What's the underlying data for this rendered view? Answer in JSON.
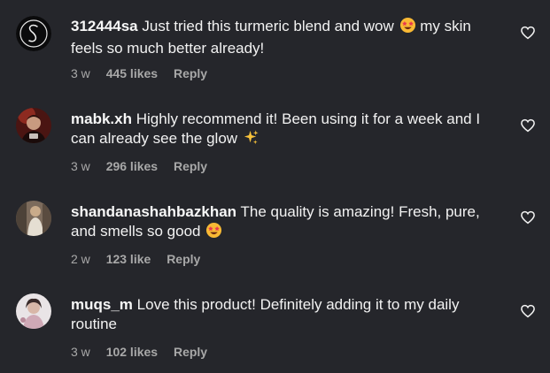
{
  "comments": [
    {
      "username": "312444sa",
      "text": "Just tried this turmeric blend and wow",
      "text_after_emoji": "my skin feels so much better already!",
      "emoji": "star-struck-emoji",
      "time": "3 w",
      "likes": "445 likes",
      "reply": "Reply"
    },
    {
      "username": "mabk.xh",
      "text": "Highly recommend it! Been using it for a week and I can already see the glow",
      "text_after_emoji": "",
      "emoji": "sparkles-emoji",
      "time": "3 w",
      "likes": "296 likes",
      "reply": "Reply"
    },
    {
      "username": "shandanashahbazkhan",
      "text": "The quality is amazing! Fresh, pure, and smells so good",
      "text_after_emoji": "",
      "emoji": "star-struck-emoji",
      "time": "2 w",
      "likes": "123 like",
      "reply": "Reply"
    },
    {
      "username": "muqs_m",
      "text": "Love this product! Definitely adding it to my daily routine",
      "text_after_emoji": "",
      "emoji": "",
      "time": "3 w",
      "likes": "102 likes",
      "reply": "Reply"
    }
  ],
  "icons": {
    "like": "heart-outline-icon"
  },
  "colors": {
    "background": "#25262b",
    "text": "#f2f2f2",
    "meta": "#a8a8a8"
  }
}
